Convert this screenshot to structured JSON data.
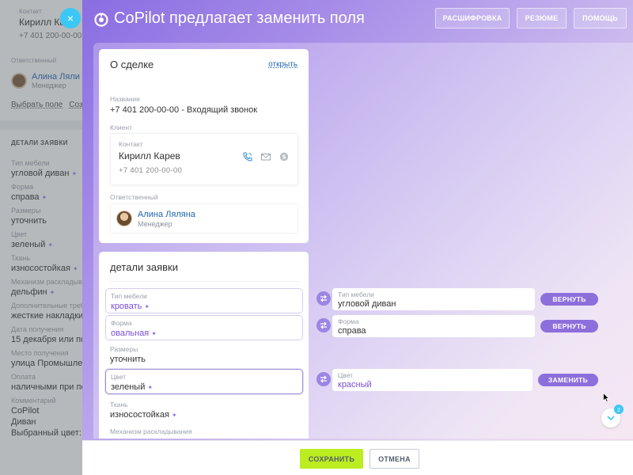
{
  "background": {
    "contact_label": "Контакт",
    "contact_name": "Кирилл Кар",
    "contact_phone": "+7 401 200-00-00",
    "responsible_label": "Ответственный",
    "responsible_name": "Алина Ляли",
    "responsible_role": "Менеджер",
    "link_select": "Выбрать поле",
    "link_create": "Созд",
    "details_title": "ДЕТАЛИ ЗАЯВКИ",
    "fields": [
      {
        "label": "Тип мебели",
        "value": "угловой диван",
        "sparkle": true
      },
      {
        "label": "Форма",
        "value": "справа",
        "sparkle": true
      },
      {
        "label": "Размеры",
        "value": "уточнить",
        "sparkle": false
      },
      {
        "label": "Цвет",
        "value": "зеленый",
        "sparkle": true
      },
      {
        "label": "Ткань",
        "value": "износостойкая",
        "sparkle": true
      },
      {
        "label": "Механизм раскладыва",
        "value": "дельфин",
        "sparkle": true
      },
      {
        "label": "Дополнительные треб",
        "value": "жесткие накладки",
        "sparkle": false
      },
      {
        "label": "Дата получения",
        "value": "15 декабря или поз",
        "sparkle": false
      },
      {
        "label": "Место получения",
        "value": "улица Промышлен",
        "sparkle": false
      },
      {
        "label": "Оплата",
        "value": "наличными при по",
        "sparkle": false
      },
      {
        "label": "Комментарий",
        "value": "CoPilot",
        "sparkle": false
      }
    ],
    "comment_lines": [
      "Диван",
      "Выбранный цвет: з"
    ]
  },
  "close_icon": "×",
  "header": {
    "title": "CoPilot предлагает заменить поля",
    "buttons": {
      "transcript": "РАСШИФРОВКА",
      "summary": "РЕЗЮМЕ",
      "help": "ПОМОЩЬ"
    }
  },
  "about": {
    "title": "О сделке",
    "open_link": "открыть",
    "name_label": "Название",
    "name_value": "+7 401 200-00-00 - Входящий звонок",
    "client_label": "Клиент",
    "contact_label": "Контакт",
    "contact_name": "Кирилл Карев",
    "contact_phone": "+7 401 200-00-00",
    "responsible_label": "Ответственный",
    "responsible_name": "Алина Ляляна",
    "responsible_role": "Менеджер"
  },
  "details": {
    "title": "детали заявки",
    "fields": {
      "furniture_type": {
        "label": "Тип мебели",
        "value": "кровать"
      },
      "shape": {
        "label": "Форма",
        "value": "овальная"
      },
      "sizes": {
        "label": "Размеры",
        "value": "уточнить"
      },
      "color": {
        "label": "Цвет",
        "value": "зеленый"
      },
      "fabric": {
        "label": "Ткань",
        "value": "износостойкая"
      },
      "mechanism": {
        "label": "Механизм раскладывания"
      }
    }
  },
  "suggestions": {
    "furniture_type": {
      "label": "Тип мебели",
      "value": "угловой диван",
      "action": "ВЕРНУТЬ"
    },
    "shape": {
      "label": "Форма",
      "value": "справа",
      "action": "ВЕРНУТЬ"
    },
    "color": {
      "label": "Цвет",
      "value": "красный",
      "action": "ЗАМЕНИТЬ"
    }
  },
  "badge_count": "2",
  "footer": {
    "save": "СОХРАНИТЬ",
    "cancel": "ОТМЕНА"
  },
  "colors": {
    "accent": "#8d6fdc",
    "save": "#bbed21",
    "link": "#2067b0",
    "close": "#3bc8f5"
  }
}
